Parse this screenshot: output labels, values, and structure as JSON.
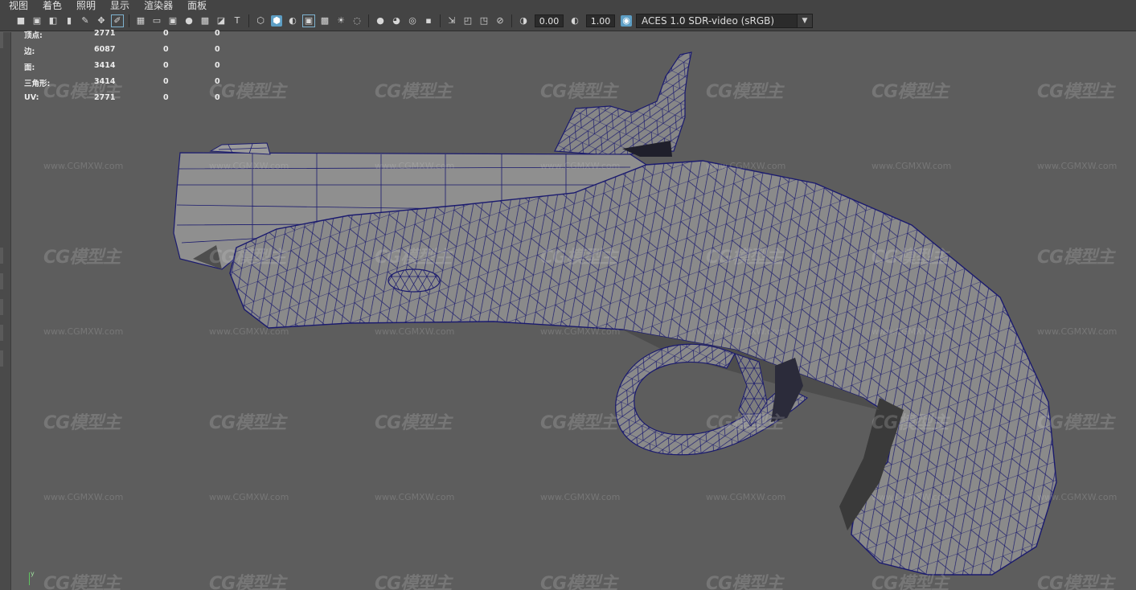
{
  "menu": [
    "视图",
    "着色",
    "照明",
    "显示",
    "渲染器",
    "面板"
  ],
  "toolbar": {
    "groups": [
      [
        "camera-icon",
        "camera-attributes-icon",
        "camera-bookmark-icon",
        "bookmark-icon",
        "image-plane-icon",
        "pan-zoom-icon",
        "grease-pencil-icon"
      ],
      [
        "grid-icon",
        "film-gate-icon",
        "resolution-gate-icon",
        "gate-mask-icon",
        "field-chart-icon",
        "safe-action-icon",
        "safe-title-icon"
      ],
      [
        "wireframe-icon",
        "smooth-shade-icon",
        "wireframe-on-shaded-icon",
        "textured-icon",
        "all-lights-icon",
        "shadows-icon"
      ],
      [
        "ambient-occlusion-icon",
        "motion-blur-icon",
        "antialiasing-icon",
        "depth-of-field-icon"
      ],
      [
        "isolate-select-icon",
        "xray-icon",
        "xray-joints-icon",
        "xray-components-icon"
      ],
      [
        "exposure-icon",
        "gamma-icon"
      ]
    ],
    "exposure": "0.00",
    "gamma": "1.00",
    "color_management_icon": "color-management-icon",
    "view_transform": "ACES 1.0 SDR-video (sRGB)"
  },
  "hud": {
    "rows": [
      {
        "label": "顶点:",
        "v1": "2771",
        "v2": "0",
        "v3": "0"
      },
      {
        "label": "边:",
        "v1": "6087",
        "v2": "0",
        "v3": "0"
      },
      {
        "label": "面:",
        "v1": "3414",
        "v2": "0",
        "v3": "0"
      },
      {
        "label": "三角形:",
        "v1": "3414",
        "v2": "0",
        "v3": "0"
      },
      {
        "label": "UV:",
        "v1": "2771",
        "v2": "0",
        "v3": "0"
      }
    ]
  },
  "watermark": {
    "logo": "CG模型主",
    "url": "www.CGMXW.com"
  },
  "axis": {
    "label": "y"
  },
  "colors": {
    "viewport_bg": "#5d5d5d",
    "wire": "#1a1a6e",
    "mesh_fill": "#8a8a8a",
    "active_icon": "#5d9ec4"
  }
}
